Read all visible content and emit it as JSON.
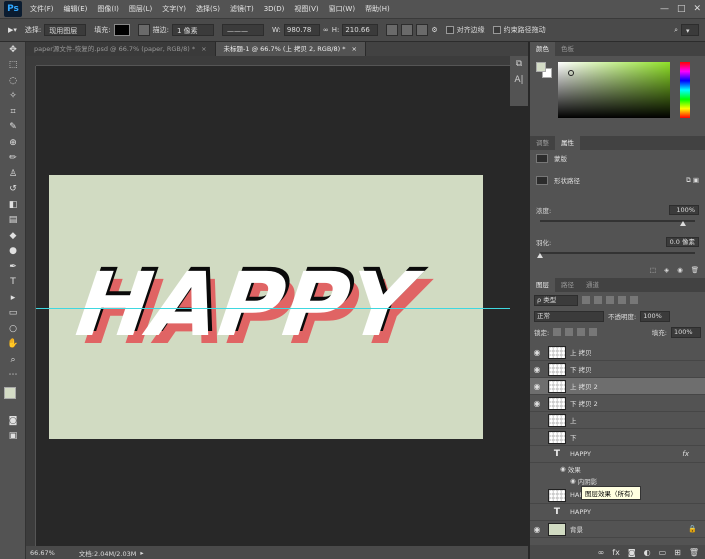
{
  "app": {
    "logo": "Ps"
  },
  "menu": [
    "文件(F)",
    "编辑(E)",
    "图像(I)",
    "图层(L)",
    "文字(Y)",
    "选择(S)",
    "滤镜(T)",
    "3D(D)",
    "视图(V)",
    "窗口(W)",
    "帮助(H)"
  ],
  "window_controls": {
    "minimize": "—",
    "maximize": "□",
    "close": "✕"
  },
  "options": {
    "select_label": "选择:",
    "select_value": "现用图层",
    "fill_label": "填充:",
    "stroke_label": "描边:",
    "stroke_width": "1 像素",
    "w_label": "W:",
    "w_value": "980.78",
    "h_label": "H:",
    "h_value": "210.66",
    "align_edges": "对齐边缘",
    "constrain": "约束路径拖动"
  },
  "tabs": [
    {
      "label": "paper源文件-恢复的.psd @ 66.7% (paper, RGB/8) *",
      "close": "×"
    },
    {
      "label": "未标题-1 @ 66.7% (上 拷贝 2, RGB/8) *",
      "close": "×"
    }
  ],
  "canvas_text": "HAPPY",
  "colors": {
    "canvas_bg": "#d1dbc2",
    "text_main": "#ffffff",
    "shadow_red": "#e06464",
    "shadow_black": "#0a0a0a",
    "guide": "#3fd8e0"
  },
  "status": {
    "zoom": "66.67%",
    "doc": "文档:2.04M/2.03M"
  },
  "color_panel": {
    "tab1": "颜色",
    "tab2": "色板"
  },
  "props_panel": {
    "tab1": "调整",
    "tab2": "属性",
    "mask_label": "蒙版",
    "shape_label": "形状路径",
    "density_label": "浓度:",
    "density_value": "100%",
    "feather_label": "羽化:",
    "feather_value": "0.0 像素"
  },
  "layers_panel": {
    "tab1": "图层",
    "tab2": "路径",
    "tab3": "通道",
    "filter": "ρ 类型",
    "blend": "正常",
    "opacity_label": "不透明度:",
    "opacity_value": "100%",
    "lock_label": "锁定:",
    "fill_label": "填充:",
    "fill_value": "100%",
    "layers": [
      {
        "name": "上 拷贝",
        "visible": true,
        "type": "pixel",
        "selected": false
      },
      {
        "name": "下 拷贝",
        "visible": true,
        "type": "pixel",
        "selected": false
      },
      {
        "name": "上 拷贝 2",
        "visible": true,
        "type": "pixel",
        "selected": true
      },
      {
        "name": "下 拷贝 2",
        "visible": true,
        "type": "pixel",
        "selected": false
      },
      {
        "name": "上",
        "visible": false,
        "type": "pixel",
        "selected": false
      },
      {
        "name": "下",
        "visible": false,
        "type": "pixel",
        "selected": false
      }
    ],
    "text_layer_1": "HAPPY",
    "fx_symbol": "fx",
    "effects_label": "效果",
    "inner_shadow_label": "内阴影",
    "tooltip": "图层效果（所有）",
    "text_layer_2": "HAPPY",
    "text_layer_3": "HAPPY",
    "background_layer": "背景"
  }
}
